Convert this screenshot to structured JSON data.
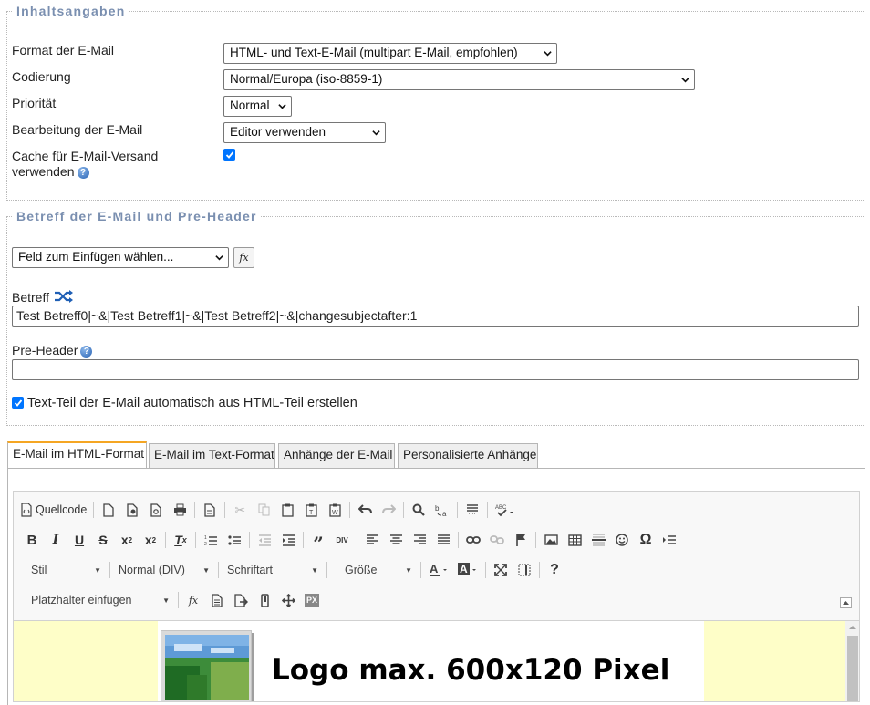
{
  "content_section": {
    "legend": "Inhaltsangaben",
    "format_label": "Format der E-Mail",
    "format_value": "HTML- und Text-E-Mail (multipart E-Mail, empfohlen)",
    "encoding_label": "Codierung",
    "encoding_value": "Normal/Europa (iso-8859-1)",
    "priority_label": "Priorität",
    "priority_value": "Normal",
    "editing_label": "Bearbeitung der E-Mail",
    "editing_value": "Editor verwenden",
    "cache_label_line1": "Cache für E-Mail-Versand",
    "cache_label_line2": "verwenden",
    "cache_checked": true
  },
  "subject_section": {
    "legend": "Betreff der E-Mail und Pre-Header",
    "insert_field_value": "Feld zum Einfügen wählen...",
    "fx_label": "fx",
    "subject_label": "Betreff",
    "subject_value": "Test Betreff0|~&|Test Betreff1|~&|Test Betreff2|~&|changesubjectafter:1",
    "preheader_label": "Pre-Header",
    "preheader_value": "",
    "autotext_label": "Text-Teil der E-Mail automatisch aus HTML-Teil erstellen",
    "autotext_checked": true
  },
  "tabs": [
    {
      "label": "E-Mail im HTML-Format",
      "active": true
    },
    {
      "label": "E-Mail im Text-Format",
      "active": false
    },
    {
      "label": "Anhänge der E-Mail",
      "active": false
    },
    {
      "label": "Personalisierte Anhänge",
      "active": false
    }
  ],
  "editor": {
    "source_label": "Quellcode",
    "style_combo": "Stil",
    "format_combo": "Normal (DIV)",
    "font_combo": "Schriftart",
    "size_combo": "Größe",
    "placeholder_combo": "Platzhalter einfügen",
    "logo_text": "Logo max. 600x120 Pixel",
    "colors": {
      "page_bg": "#fefec8",
      "accent_tab": "#f5a623",
      "checkbox": "#0075ff"
    }
  }
}
